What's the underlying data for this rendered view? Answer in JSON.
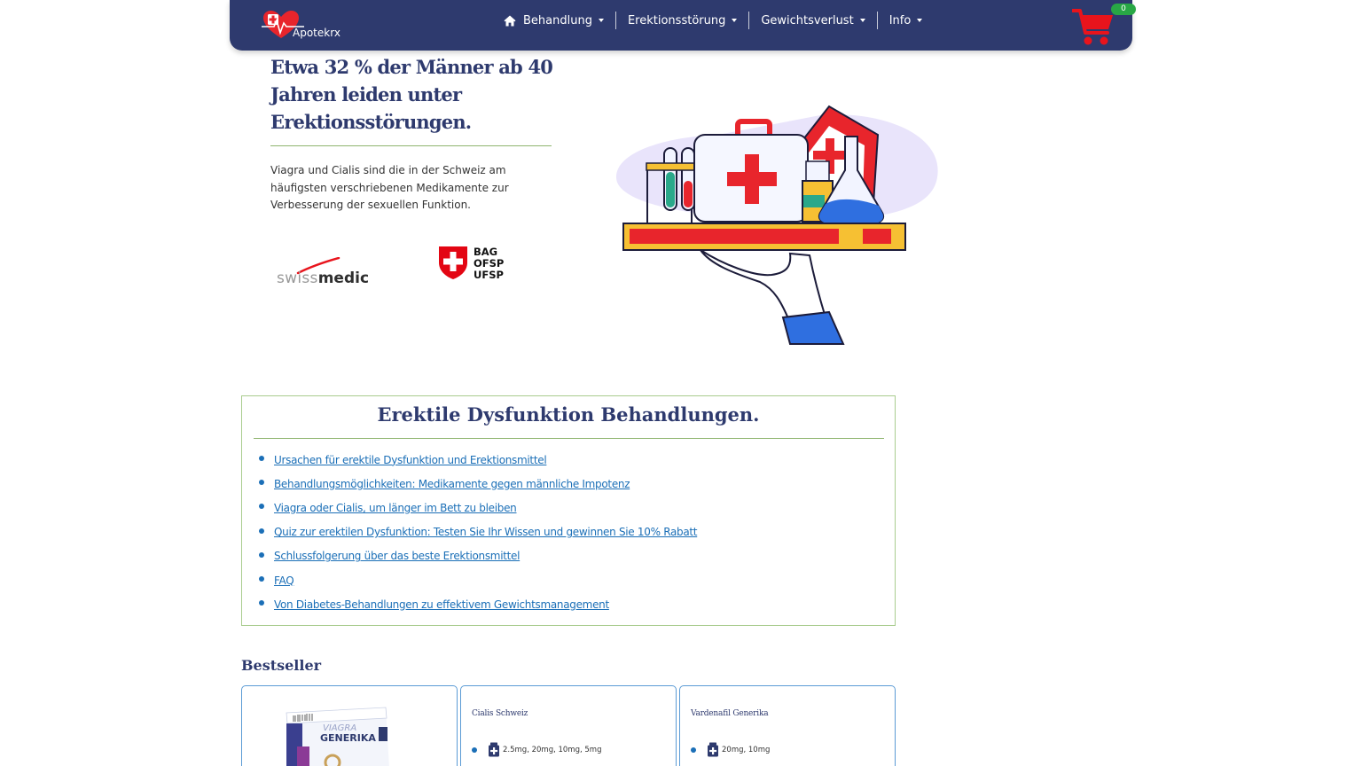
{
  "brand": {
    "name": "Apotekrx"
  },
  "nav": {
    "items": [
      {
        "label": "Behandlung",
        "icon": "home-icon"
      },
      {
        "label": "Erektionsstörung"
      },
      {
        "label": "Gewichtsverlust"
      },
      {
        "label": "Info"
      }
    ],
    "cart_count": "0"
  },
  "hero": {
    "title": "Etwa 32 % der Männer ab 40 Jahren leiden unter Erektionsstörungen.",
    "text": "Viagra und Cialis sind die in der Schweiz am häufigsten verschriebenen Medikamente zur Verbesserung der sexuellen Funktion.",
    "logo_swissmedic_light": "swiss",
    "logo_swissmedic_bold": "medic",
    "logo_bag_lines": [
      "BAG",
      "OFSP",
      "UFSP"
    ]
  },
  "toc": {
    "title": "Erektile Dysfunktion Behandlungen.",
    "links": [
      "Ursachen für erektile Dysfunktion und Erektionsmittel",
      "Behandlungsmöglichkeiten: Medikamente gegen männliche Impotenz",
      "Viagra oder Cialis, um länger im Bett zu bleiben",
      "Quiz zur erektilen Dysfunktion: Testen Sie Ihr Wissen und gewinnen Sie 10% Rabatt",
      "Schlussfolgerung über das beste Erektionsmittel",
      "FAQ",
      "Von Diabetes-Behandlungen zu effektivem Gewichtsmanagement"
    ]
  },
  "bestseller": {
    "heading": "Bestseller",
    "cards": [
      {
        "box_brand": "VIAGRA",
        "box_sub": "GENERIKA"
      },
      {
        "name": "Cialis Schweiz",
        "doses": "2.5mg, 20mg, 10mg, 5mg"
      },
      {
        "name": "Vardenafil Generika",
        "doses": "20mg, 10mg"
      }
    ]
  },
  "colors": {
    "navbar": "#2e3a6e",
    "accent_green": "#8fb46f",
    "link_blue": "#1b6fb7",
    "cart_red": "#e8141c",
    "badge_green": "#28a745"
  }
}
